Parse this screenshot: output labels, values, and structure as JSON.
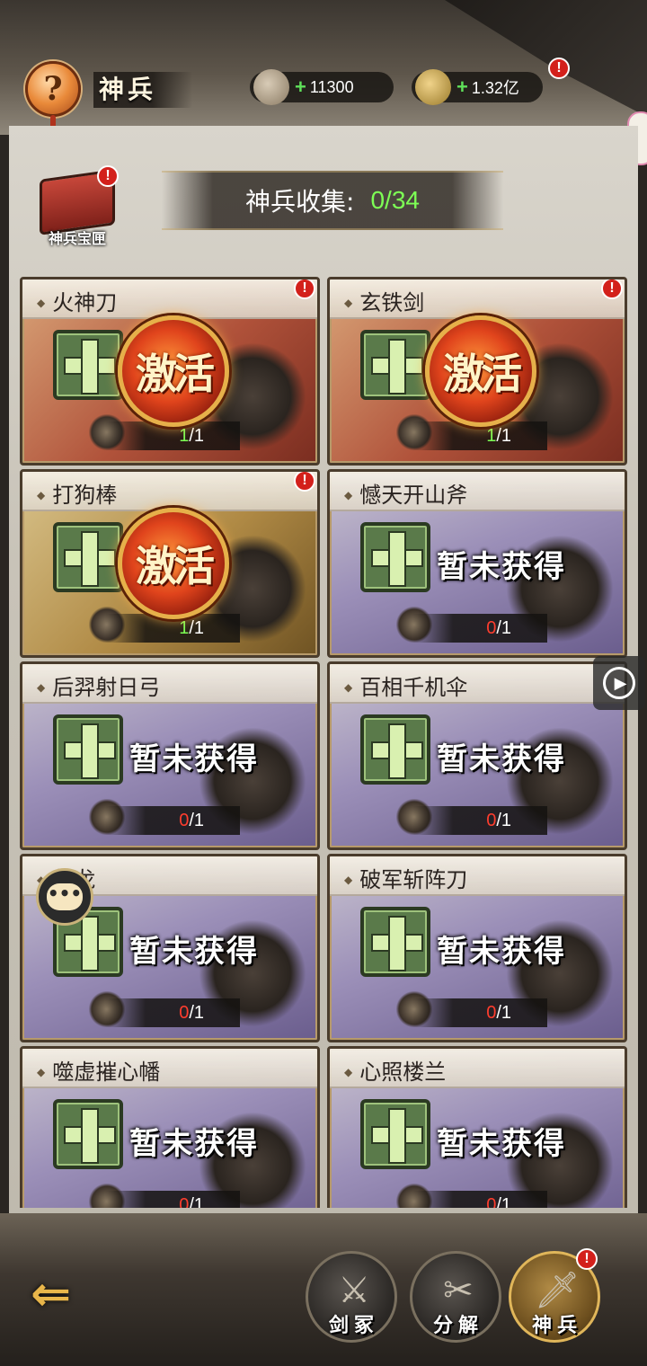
{
  "header": {
    "title": "神兵",
    "help_symbol": "?",
    "currency1": {
      "icon": "stone-icon",
      "plus": "+",
      "amount": "11300"
    },
    "currency2": {
      "icon": "coins-icon",
      "plus": "+",
      "amount": "1.32亿"
    },
    "alert": "!"
  },
  "treasure_box": {
    "label": "神兵宝匣",
    "alert": "!"
  },
  "collection": {
    "label": "神兵收集:",
    "value": "0/34"
  },
  "activate_label": "激活",
  "unowned_label": "暂未获得",
  "cards": [
    {
      "name": "火神刀",
      "have": "1",
      "total": "/1",
      "state": "activate",
      "theme": "red",
      "alert": "!"
    },
    {
      "name": "玄铁剑",
      "have": "1",
      "total": "/1",
      "state": "activate",
      "theme": "red",
      "alert": "!"
    },
    {
      "name": "打狗棒",
      "have": "1",
      "total": "/1",
      "state": "activate",
      "theme": "gold",
      "alert": "!"
    },
    {
      "name": "憾天开山斧",
      "have": "0",
      "total": "/1",
      "state": "unowned",
      "theme": "purple",
      "alert": ""
    },
    {
      "name": "后羿射日弓",
      "have": "0",
      "total": "/1",
      "state": "unowned",
      "theme": "purple",
      "alert": ""
    },
    {
      "name": "百相千机伞",
      "have": "0",
      "total": "/1",
      "state": "unowned",
      "theme": "purple",
      "alert": ""
    },
    {
      "name": "戟龙",
      "have": "0",
      "total": "/1",
      "state": "unowned",
      "theme": "purple",
      "alert": ""
    },
    {
      "name": "破军斩阵刀",
      "have": "0",
      "total": "/1",
      "state": "unowned",
      "theme": "purple",
      "alert": ""
    },
    {
      "name": "噬虚摧心幡",
      "have": "0",
      "total": "/1",
      "state": "unowned",
      "theme": "purple",
      "alert": ""
    },
    {
      "name": "心照楼兰",
      "have": "0",
      "total": "/1",
      "state": "unowned",
      "theme": "purple",
      "alert": ""
    }
  ],
  "bottom_nav": {
    "back_icon": "back-arrow-icon",
    "items": [
      {
        "label": "剑冢",
        "icon": "sword-tomb-icon"
      },
      {
        "label": "分解",
        "icon": "decompose-icon"
      },
      {
        "label": "神兵",
        "icon": "divine-weapon-icon",
        "active": true,
        "alert": "!"
      }
    ]
  },
  "floating": {
    "play_icon": "play-icon",
    "chat_icon": "chat-icon",
    "chat_symbol": "•••",
    "play_symbol": "▶"
  }
}
